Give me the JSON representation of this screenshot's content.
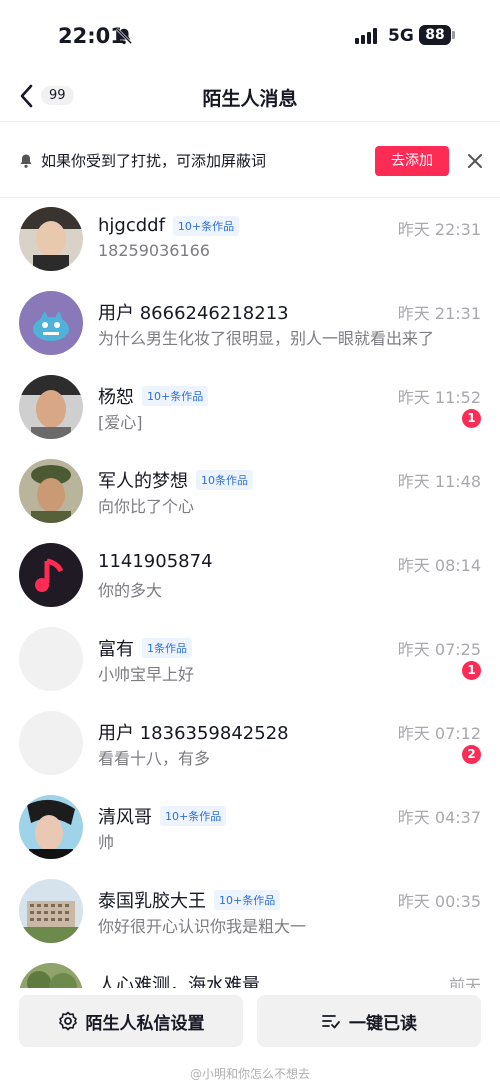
{
  "status_bar": {
    "time": "22:01",
    "network": "5G",
    "battery": "88"
  },
  "nav": {
    "back_count": "99",
    "title": "陌生人消息"
  },
  "notice": {
    "text": "如果你受到了打扰，可添加屏蔽词",
    "button_label": "去添加"
  },
  "conversations": [
    {
      "name": "hjgcddf",
      "tag": "10+条作品",
      "time": "昨天 22:31",
      "preview": "18259036166",
      "unread": ""
    },
    {
      "name": "用户 8666246218213",
      "tag": "",
      "time": "昨天 21:31",
      "preview": "为什么男生化妆了很明显，别人一眼就看出来了",
      "unread": ""
    },
    {
      "name": "杨恕",
      "tag": "10+条作品",
      "time": "昨天 11:52",
      "preview": "[爱心]",
      "unread": "1"
    },
    {
      "name": "军人的梦想",
      "tag": "10条作品",
      "time": "昨天 11:48",
      "preview": "向你比了个心",
      "unread": ""
    },
    {
      "name": "1141905874",
      "tag": "",
      "time": "昨天 08:14",
      "preview": "你的多大",
      "unread": ""
    },
    {
      "name": "富有",
      "tag": "1条作品",
      "time": "昨天 07:25",
      "preview": "小帅宝早上好",
      "unread": "1"
    },
    {
      "name": "用户 1836359842528",
      "tag": "",
      "time": "昨天 07:12",
      "preview": "看看十八，有多",
      "unread": "2"
    },
    {
      "name": "清风哥",
      "tag": "10+条作品",
      "time": "昨天 04:37",
      "preview": "帅",
      "unread": ""
    },
    {
      "name": "泰国乳胶大王",
      "tag": "10+条作品",
      "time": "昨天 00:35",
      "preview": "你好很开心认识你我是粗大一",
      "unread": ""
    },
    {
      "name": "人心难测，海水难量",
      "tag": "",
      "time": "前天",
      "preview": "",
      "unread": ""
    }
  ],
  "bottom": {
    "settings_label": "陌生人私信设置",
    "mark_read_label": "一键已读"
  },
  "watermark": "@小明和你怎么不想去",
  "colors": {
    "accent": "#fe2c55",
    "tag_text": "#2c6fd8",
    "tag_bg": "#eef4fd"
  }
}
